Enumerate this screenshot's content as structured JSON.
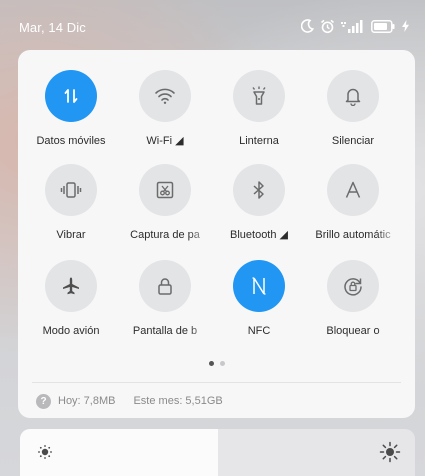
{
  "status_bar": {
    "date": "Mar, 14 Dic",
    "icons": [
      "moon-icon",
      "alarm-icon",
      "signal-icon",
      "battery-icon",
      "charging-icon"
    ]
  },
  "tiles": [
    {
      "label": "Datos móviles",
      "icon": "mobile-data-icon",
      "active": true
    },
    {
      "label": "Wi-Fi ◢",
      "icon": "wifi-icon",
      "active": false
    },
    {
      "label": "Linterna",
      "icon": "flashlight-icon",
      "active": false
    },
    {
      "label": "Silenciar",
      "icon": "bell-icon",
      "active": false
    },
    {
      "label": "Vibrar",
      "icon": "vibrate-icon",
      "active": false
    },
    {
      "label": "Captura de pa",
      "icon": "screenshot-icon",
      "active": false
    },
    {
      "label": "Bluetooth ◢",
      "icon": "bluetooth-icon",
      "active": false
    },
    {
      "label": "Brillo automátic",
      "icon": "auto-brightness-icon",
      "active": false
    },
    {
      "label": "Modo avión",
      "icon": "airplane-icon",
      "active": false
    },
    {
      "label": "Pantalla de b",
      "icon": "lock-icon",
      "active": false
    },
    {
      "label": "NFC",
      "icon": "nfc-icon",
      "active": true
    },
    {
      "label": "Bloquear o",
      "icon": "rotation-lock-icon",
      "active": false
    }
  ],
  "pager": {
    "pages": 2,
    "current": 1
  },
  "usage": {
    "icon_glyph": "?",
    "today": "Hoy: 7,8MB",
    "month": "Este mes: 5,51GB"
  },
  "brightness": {
    "level": 0.5,
    "icon_low": "brightness-low-icon",
    "icon_high": "brightness-high-icon"
  },
  "colors": {
    "accent": "#2196f3",
    "tile_inactive": "#e3e4e6",
    "panel": "#f7f7f8"
  }
}
